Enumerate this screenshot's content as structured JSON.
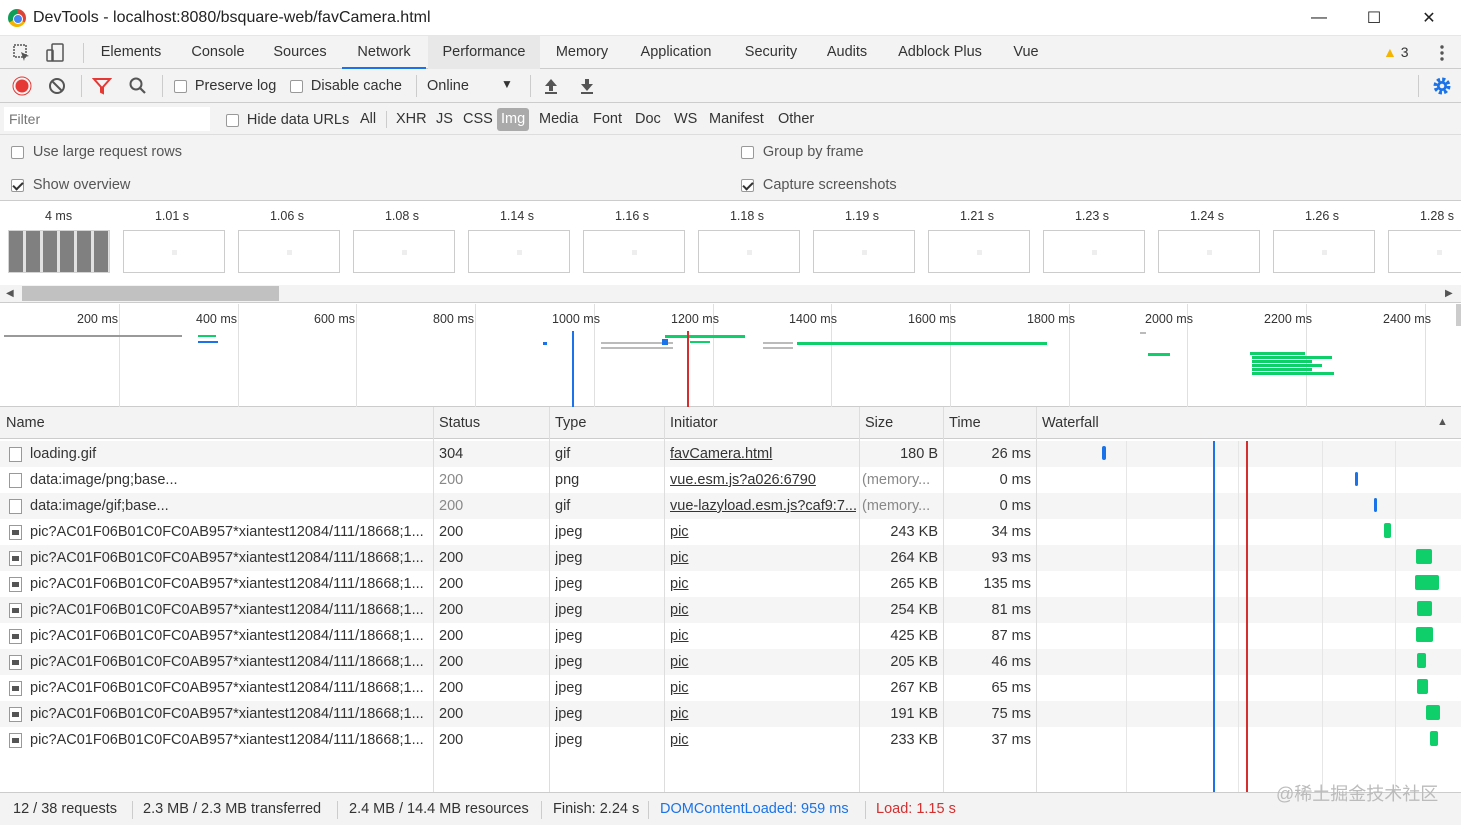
{
  "window": {
    "title": "DevTools - localhost:8080/bsquare-web/favCamera.html",
    "minimize": "—",
    "maximize": "☐",
    "close": "✕"
  },
  "tabs": [
    "Elements",
    "Console",
    "Sources",
    "Network",
    "Performance",
    "Memory",
    "Application",
    "Security",
    "Audits",
    "Adblock Plus",
    "Vue"
  ],
  "active_tab": "Network",
  "warnings": {
    "count": "3"
  },
  "toolbar": {
    "preserve_log": "Preserve log",
    "disable_cache": "Disable cache",
    "throttle": "Online"
  },
  "filter": {
    "placeholder": "Filter",
    "hide_data_urls": "Hide data URLs",
    "types": [
      "All",
      "XHR",
      "JS",
      "CSS",
      "Img",
      "Media",
      "Font",
      "Doc",
      "WS",
      "Manifest",
      "Other"
    ],
    "selected": "Img"
  },
  "settings": {
    "large_rows": "Use large request rows",
    "show_overview": "Show overview",
    "group_by_frame": "Group by frame",
    "capture_screenshots": "Capture screenshots"
  },
  "screenshots": {
    "times": [
      "4 ms",
      "1.01 s",
      "1.06 s",
      "1.08 s",
      "1.14 s",
      "1.16 s",
      "1.18 s",
      "1.19 s",
      "1.21 s",
      "1.23 s",
      "1.24 s",
      "1.26 s",
      "1.28 s"
    ]
  },
  "overview": {
    "ticks": [
      "200 ms",
      "400 ms",
      "600 ms",
      "800 ms",
      "1000 ms",
      "1200 ms",
      "1400 ms",
      "1600 ms",
      "1800 ms",
      "2000 ms",
      "2200 ms",
      "2400 ms"
    ]
  },
  "columns": {
    "name": "Name",
    "status": "Status",
    "type": "Type",
    "initiator": "Initiator",
    "size": "Size",
    "time": "Time",
    "waterfall": "Waterfall"
  },
  "rows": [
    {
      "name": "loading.gif",
      "status": "304",
      "type": "gif",
      "initiator": "favCamera.html",
      "size": "180 B",
      "time": "26 ms"
    },
    {
      "name": "data:image/png;base...",
      "status": "200",
      "type": "png",
      "initiator": "vue.esm.js?a026:6790",
      "size": "(memory...",
      "time": "0 ms"
    },
    {
      "name": "data:image/gif;base...",
      "status": "200",
      "type": "gif",
      "initiator": "vue-lazyload.esm.js?caf9:7...",
      "size": "(memory...",
      "time": "0 ms"
    },
    {
      "name": "pic?AC01F06B01C0FC0AB957*xiantest12084/111/18668;1...",
      "status": "200",
      "type": "jpeg",
      "initiator": "pic",
      "size": "243 KB",
      "time": "34 ms"
    },
    {
      "name": "pic?AC01F06B01C0FC0AB957*xiantest12084/111/18668;1...",
      "status": "200",
      "type": "jpeg",
      "initiator": "pic",
      "size": "264 KB",
      "time": "93 ms"
    },
    {
      "name": "pic?AC01F06B01C0FC0AB957*xiantest12084/111/18668;1...",
      "status": "200",
      "type": "jpeg",
      "initiator": "pic",
      "size": "265 KB",
      "time": "135 ms"
    },
    {
      "name": "pic?AC01F06B01C0FC0AB957*xiantest12084/111/18668;1...",
      "status": "200",
      "type": "jpeg",
      "initiator": "pic",
      "size": "254 KB",
      "time": "81 ms"
    },
    {
      "name": "pic?AC01F06B01C0FC0AB957*xiantest12084/111/18668;1...",
      "status": "200",
      "type": "jpeg",
      "initiator": "pic",
      "size": "425 KB",
      "time": "87 ms"
    },
    {
      "name": "pic?AC01F06B01C0FC0AB957*xiantest12084/111/18668;1...",
      "status": "200",
      "type": "jpeg",
      "initiator": "pic",
      "size": "205 KB",
      "time": "46 ms"
    },
    {
      "name": "pic?AC01F06B01C0FC0AB957*xiantest12084/111/18668;1...",
      "status": "200",
      "type": "jpeg",
      "initiator": "pic",
      "size": "267 KB",
      "time": "65 ms"
    },
    {
      "name": "pic?AC01F06B01C0FC0AB957*xiantest12084/111/18668;1...",
      "status": "200",
      "type": "jpeg",
      "initiator": "pic",
      "size": "191 KB",
      "time": "75 ms"
    },
    {
      "name": "pic?AC01F06B01C0FC0AB957*xiantest12084/111/18668;1...",
      "status": "200",
      "type": "jpeg",
      "initiator": "pic",
      "size": "233 KB",
      "time": "37 ms"
    }
  ],
  "status": {
    "requests": "12 / 38 requests",
    "transferred": "2.3 MB / 2.3 MB transferred",
    "resources": "2.4 MB / 14.4 MB resources",
    "finish": "Finish: 2.24 s",
    "dcl": "DOMContentLoaded: 959 ms",
    "load": "Load: 1.15 s"
  },
  "colors": {
    "dcl": "#1a73e8",
    "load": "#d32f2f",
    "bar": "#0fcf6a",
    "accent": "#1a73e8"
  },
  "watermark": "@稀土掘金技术社区"
}
